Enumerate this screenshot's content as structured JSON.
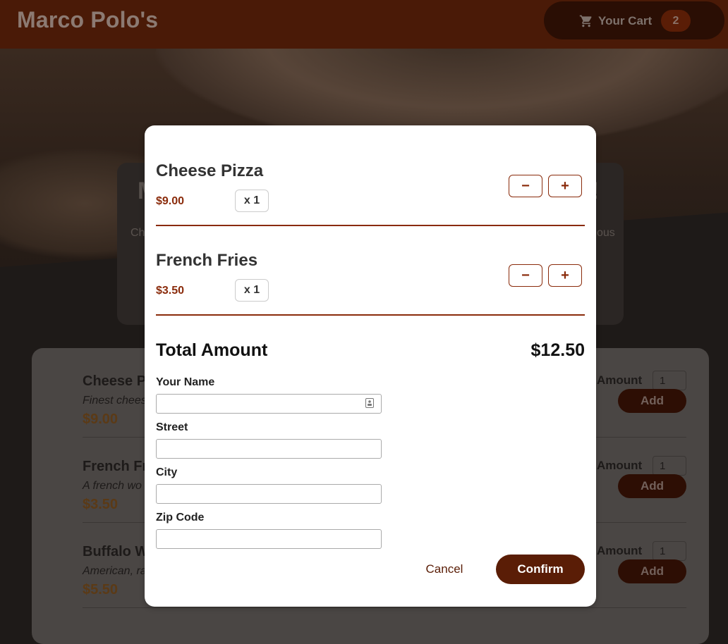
{
  "header": {
    "brand": "Marco Polo's",
    "cart_label": "Your Cart",
    "cart_count": "2"
  },
  "summary": {
    "title_left_fragment": "M",
    "title_right_fragment": "!",
    "text_left_fragment": "Ch",
    "text_right_fragment": "ous"
  },
  "menu": {
    "meals": [
      {
        "name": "Cheese Pi",
        "description": "Finest chees",
        "price": "$9.00",
        "amount_label": "Amount",
        "amount": "1",
        "add_label": "Add"
      },
      {
        "name": "French Fr",
        "description": "A french wo",
        "price": "$3.50",
        "amount_label": "Amount",
        "amount": "1",
        "add_label": "Add"
      },
      {
        "name": "Buffalo W",
        "description": "American, ra",
        "price": "$5.50",
        "amount_label": "Amount",
        "amount": "1",
        "add_label": "Add"
      }
    ]
  },
  "cart_modal": {
    "items": [
      {
        "name": "Cheese Pizza",
        "price": "$9.00",
        "quantity": "x 1",
        "minus": "−",
        "plus": "+"
      },
      {
        "name": "French Fries",
        "price": "$3.50",
        "quantity": "x 1",
        "minus": "−",
        "plus": "+"
      }
    ],
    "total_label": "Total Amount",
    "total_value": "$12.50",
    "form": {
      "name_label": "Your Name",
      "name_value": "",
      "street_label": "Street",
      "street_value": "",
      "city_label": "City",
      "city_value": "",
      "zip_label": "Zip Code",
      "zip_value": ""
    },
    "cancel_label": "Cancel",
    "confirm_label": "Confirm"
  },
  "icons": {
    "cart": "cart-icon",
    "autofill": "contact-card-icon"
  },
  "colors": {
    "brand_dark": "#5a1d06",
    "accent": "#8a2b0b"
  }
}
